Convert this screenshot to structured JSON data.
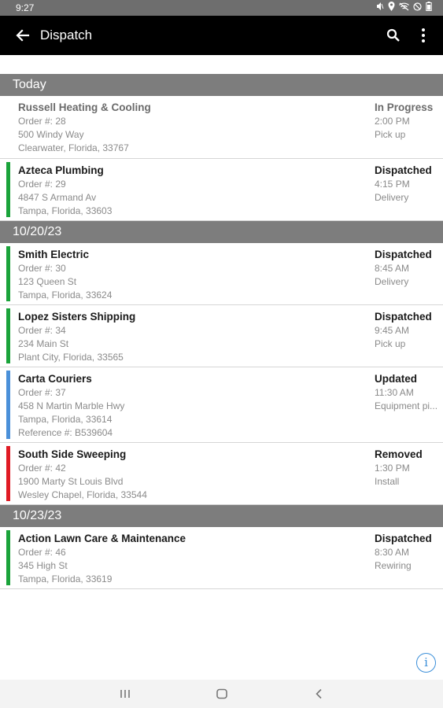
{
  "status_bar": {
    "time": "9:27",
    "icons": [
      "mute-icon",
      "location-icon",
      "wifi-off-icon",
      "dnd-icon",
      "battery-icon"
    ]
  },
  "app_bar": {
    "title": "Dispatch"
  },
  "colors": {
    "dispatched": "#1aa33a",
    "updated": "#4a90d9",
    "removed": "#e01b24",
    "section": "#7d7d7d"
  },
  "sections": [
    {
      "header": "Today",
      "items": [
        {
          "name": "Russell Heating & Cooling",
          "order": "Order #: 28",
          "address": "500 Windy Way",
          "city": "Clearwater, Florida, 33767",
          "status": "In Progress",
          "time": "2:00 PM",
          "type": "Pick up",
          "bar": "none"
        },
        {
          "name": "Azteca Plumbing",
          "order": "Order #: 29",
          "address": "4847 S Armand Av",
          "city": "Tampa, Florida, 33603",
          "status": "Dispatched",
          "time": "4:15 PM",
          "type": "Delivery",
          "bar": "dispatched"
        }
      ]
    },
    {
      "header": "10/20/23",
      "items": [
        {
          "name": "Smith Electric",
          "order": "Order #: 30",
          "address": "123 Queen St",
          "city": "Tampa, Florida, 33624",
          "status": "Dispatched",
          "time": "8:45 AM",
          "type": "Delivery",
          "bar": "dispatched"
        },
        {
          "name": "Lopez Sisters Shipping",
          "order": "Order #: 34",
          "address": "234 Main St",
          "city": "Plant City, Florida, 33565",
          "status": "Dispatched",
          "time": "9:45 AM",
          "type": "Pick up",
          "bar": "dispatched"
        },
        {
          "name": "Carta Couriers",
          "order": "Order #: 37",
          "address": "458 N Martin Marble Hwy",
          "city": "Tampa, Florida, 33614",
          "reference": "Reference #: B539604",
          "status": "Updated",
          "time": "11:30 AM",
          "type": "Equipment pi...",
          "bar": "updated"
        },
        {
          "name": "South Side Sweeping",
          "order": "Order #: 42",
          "address": "1900 Marty St Louis Blvd",
          "city": "Wesley Chapel, Florida, 33544",
          "status": "Removed",
          "time": "1:30 PM",
          "type": "Install",
          "bar": "removed"
        }
      ]
    },
    {
      "header": "10/23/23",
      "items": [
        {
          "name": "Action Lawn Care & Maintenance",
          "order": "Order #: 46",
          "address": "345 High St",
          "city": "Tampa, Florida, 33619",
          "status": "Dispatched",
          "time": "8:30 AM",
          "type": "Rewiring",
          "bar": "dispatched"
        }
      ]
    }
  ]
}
